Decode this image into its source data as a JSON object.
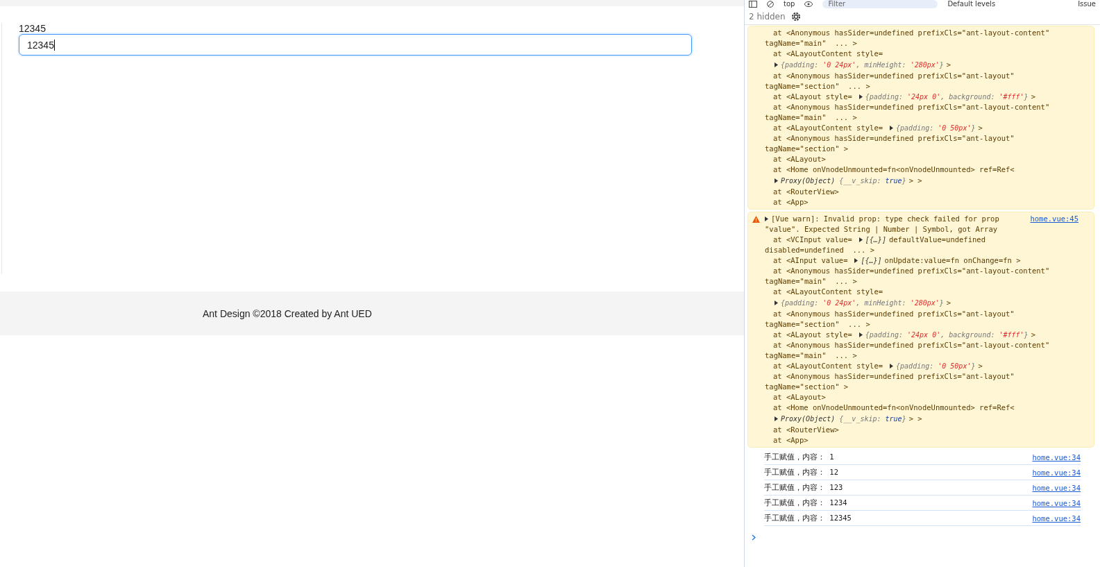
{
  "page": {
    "label": "12345",
    "input": {
      "value": "12345",
      "focused": true
    },
    "footer": "Ant Design ©2018 Created by Ant UED"
  },
  "devtools": {
    "toolbar": {
      "context": "top",
      "filter": {
        "placeholder": "Filter"
      },
      "levels": "Default levels",
      "issues": "Issue"
    },
    "hidden": "2 hidden",
    "messages": [
      {
        "kind": "warn",
        "lines": [
          {
            "kind": "frame",
            "text": "at <Anonymous hasSider=undefined prefixCls=\"ant-layout-content\""
          },
          {
            "kind": "cont",
            "text": "tagName=\"main\"  ... >"
          },
          {
            "kind": "frame",
            "text": "at <ALayoutContent style="
          },
          {
            "kind": "obj",
            "object": [
              {
                "kind": "key",
                "text": "{padding: "
              },
              {
                "kind": "string",
                "text": "'0 24px'"
              },
              {
                "kind": "key",
                "text": ", minHeight: "
              },
              {
                "kind": "string",
                "text": "'280px'"
              },
              {
                "kind": "key",
                "text": "}"
              }
            ],
            "tail": ">"
          },
          {
            "kind": "frame",
            "text": "at <Anonymous hasSider=undefined prefixCls=\"ant-layout\""
          },
          {
            "kind": "cont",
            "text": "tagName=\"section\"  ... >"
          },
          {
            "kind": "frame",
            "text": "at <ALayout style=",
            "object": [
              {
                "kind": "key",
                "text": "{padding: "
              },
              {
                "kind": "string",
                "text": "'24px 0'"
              },
              {
                "kind": "key",
                "text": ", background: "
              },
              {
                "kind": "string",
                "text": "'#fff'"
              },
              {
                "kind": "key",
                "text": "}"
              }
            ],
            "tail": ">"
          },
          {
            "kind": "frame",
            "text": "at <Anonymous hasSider=undefined prefixCls=\"ant-layout-content\""
          },
          {
            "kind": "cont",
            "text": "tagName=\"main\"  ... >"
          },
          {
            "kind": "frame",
            "text": "at <ALayoutContent style=",
            "object": [
              {
                "kind": "key",
                "text": "{padding: "
              },
              {
                "kind": "string",
                "text": "'0 50px'"
              },
              {
                "kind": "key",
                "text": "}"
              }
            ],
            "tail": ">"
          },
          {
            "kind": "frame",
            "text": "at <Anonymous hasSider=undefined prefixCls=\"ant-layout\""
          },
          {
            "kind": "cont",
            "text": "tagName=\"section\" >"
          },
          {
            "kind": "frame",
            "text": "at <ALayout>"
          },
          {
            "kind": "frame",
            "text": "at <Home onVnodeUnmounted=fn<onVnodeUnmounted> ref=Ref<"
          },
          {
            "kind": "obj",
            "object": [
              {
                "kind": "plain",
                "text": "Proxy(Object) "
              },
              {
                "kind": "key",
                "text": "{__v_skip: "
              },
              {
                "kind": "bool",
                "text": "true"
              },
              {
                "kind": "key",
                "text": "}"
              }
            ],
            "tail": "> >"
          },
          {
            "kind": "frame",
            "text": "at <RouterView>"
          },
          {
            "kind": "frame",
            "text": "at <App>"
          }
        ]
      },
      {
        "kind": "warn",
        "head": "[Vue warn]: Invalid prop: type check failed for prop",
        "source": "home.vue:45",
        "lines": [
          {
            "kind": "cont",
            "text": "\"value\". Expected String | Number | Symbol, got Array"
          },
          {
            "kind": "frame",
            "text": "at <VCInput value=",
            "object": [
              {
                "kind": "plain",
                "text": "[{…}]"
              }
            ],
            "tail": "defaultValue=undefined"
          },
          {
            "kind": "cont",
            "text": "disabled=undefined  ... >"
          },
          {
            "kind": "frame",
            "text": "at <AInput value=",
            "object": [
              {
                "kind": "plain",
                "text": "[{…}]"
              }
            ],
            "tail": "onUpdate:value=fn onChange=fn >"
          },
          {
            "kind": "frame",
            "text": "at <Anonymous hasSider=undefined prefixCls=\"ant-layout-content\""
          },
          {
            "kind": "cont",
            "text": "tagName=\"main\"  ... >"
          },
          {
            "kind": "frame",
            "text": "at <ALayoutContent style="
          },
          {
            "kind": "obj",
            "object": [
              {
                "kind": "key",
                "text": "{padding: "
              },
              {
                "kind": "string",
                "text": "'0 24px'"
              },
              {
                "kind": "key",
                "text": ", minHeight: "
              },
              {
                "kind": "string",
                "text": "'280px'"
              },
              {
                "kind": "key",
                "text": "}"
              }
            ],
            "tail": ">"
          },
          {
            "kind": "frame",
            "text": "at <Anonymous hasSider=undefined prefixCls=\"ant-layout\""
          },
          {
            "kind": "cont",
            "text": "tagName=\"section\"  ... >"
          },
          {
            "kind": "frame",
            "text": "at <ALayout style=",
            "object": [
              {
                "kind": "key",
                "text": "{padding: "
              },
              {
                "kind": "string",
                "text": "'24px 0'"
              },
              {
                "kind": "key",
                "text": ", background: "
              },
              {
                "kind": "string",
                "text": "'#fff'"
              },
              {
                "kind": "key",
                "text": "}"
              }
            ],
            "tail": ">"
          },
          {
            "kind": "frame",
            "text": "at <Anonymous hasSider=undefined prefixCls=\"ant-layout-content\""
          },
          {
            "kind": "cont",
            "text": "tagName=\"main\"  ... >"
          },
          {
            "kind": "frame",
            "text": "at <ALayoutContent style=",
            "object": [
              {
                "kind": "key",
                "text": "{padding: "
              },
              {
                "kind": "string",
                "text": "'0 50px'"
              },
              {
                "kind": "key",
                "text": "}"
              }
            ],
            "tail": ">"
          },
          {
            "kind": "frame",
            "text": "at <Anonymous hasSider=undefined prefixCls=\"ant-layout\""
          },
          {
            "kind": "cont",
            "text": "tagName=\"section\" >"
          },
          {
            "kind": "frame",
            "text": "at <ALayout>"
          },
          {
            "kind": "frame",
            "text": "at <Home onVnodeUnmounted=fn<onVnodeUnmounted> ref=Ref<"
          },
          {
            "kind": "obj",
            "object": [
              {
                "kind": "plain",
                "text": "Proxy(Object) "
              },
              {
                "kind": "key",
                "text": "{__v_skip: "
              },
              {
                "kind": "bool",
                "text": "true"
              },
              {
                "kind": "key",
                "text": "}"
              }
            ],
            "tail": "> >"
          },
          {
            "kind": "frame",
            "text": "at <RouterView>"
          },
          {
            "kind": "frame",
            "text": "at <App>"
          }
        ]
      },
      {
        "kind": "log",
        "head": "手工赋值，内容： 1",
        "source": "home.vue:34"
      },
      {
        "kind": "log",
        "head": "手工赋值，内容： 12",
        "source": "home.vue:34"
      },
      {
        "kind": "log",
        "head": "手工赋值，内容： 123",
        "source": "home.vue:34"
      },
      {
        "kind": "log",
        "head": "手工赋值，内容： 1234",
        "source": "home.vue:34"
      },
      {
        "kind": "log",
        "head": "手工赋值，内容： 12345",
        "source": "home.vue:34"
      }
    ]
  }
}
